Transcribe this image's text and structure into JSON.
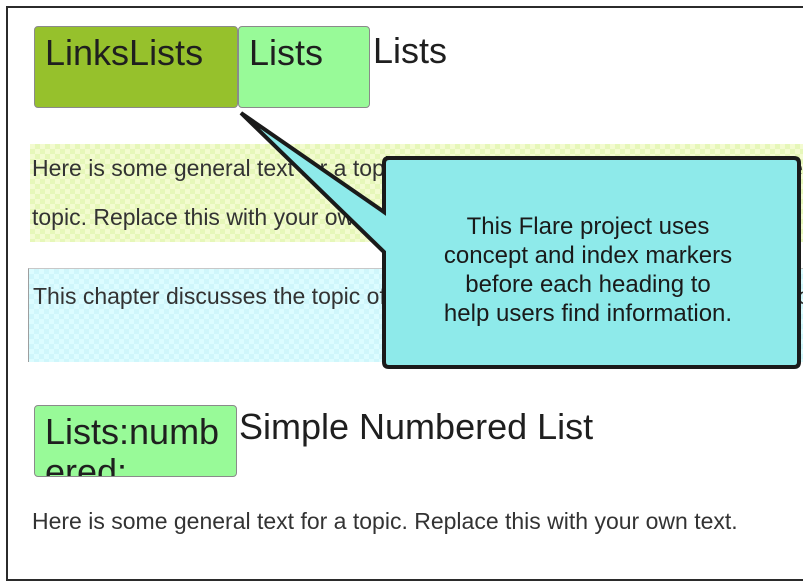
{
  "markers": {
    "links_lists": "LinksLists",
    "lists": "Lists",
    "lists_numbered": "Lists:numbered:"
  },
  "headings": {
    "lists": "Lists",
    "simple_numbered_list": "Simple Numbered List"
  },
  "paragraphs": {
    "general_line1": "Here is some general text for a topic. Replace this with your own text for the",
    "general_line2": "topic. Replace this with your own text.",
    "chapter": "This chapter discusses the topic of lists and what you can do with them in your",
    "general_numbered": "Here is some general text for a topic. Replace this with your own text."
  },
  "callout": {
    "line1": "This Flare project uses",
    "line2": "concept and index markers",
    "line3": "before each heading to",
    "line4": "help users find information.",
    "fill": "#8eeaea",
    "border": "#1a1a1a"
  }
}
